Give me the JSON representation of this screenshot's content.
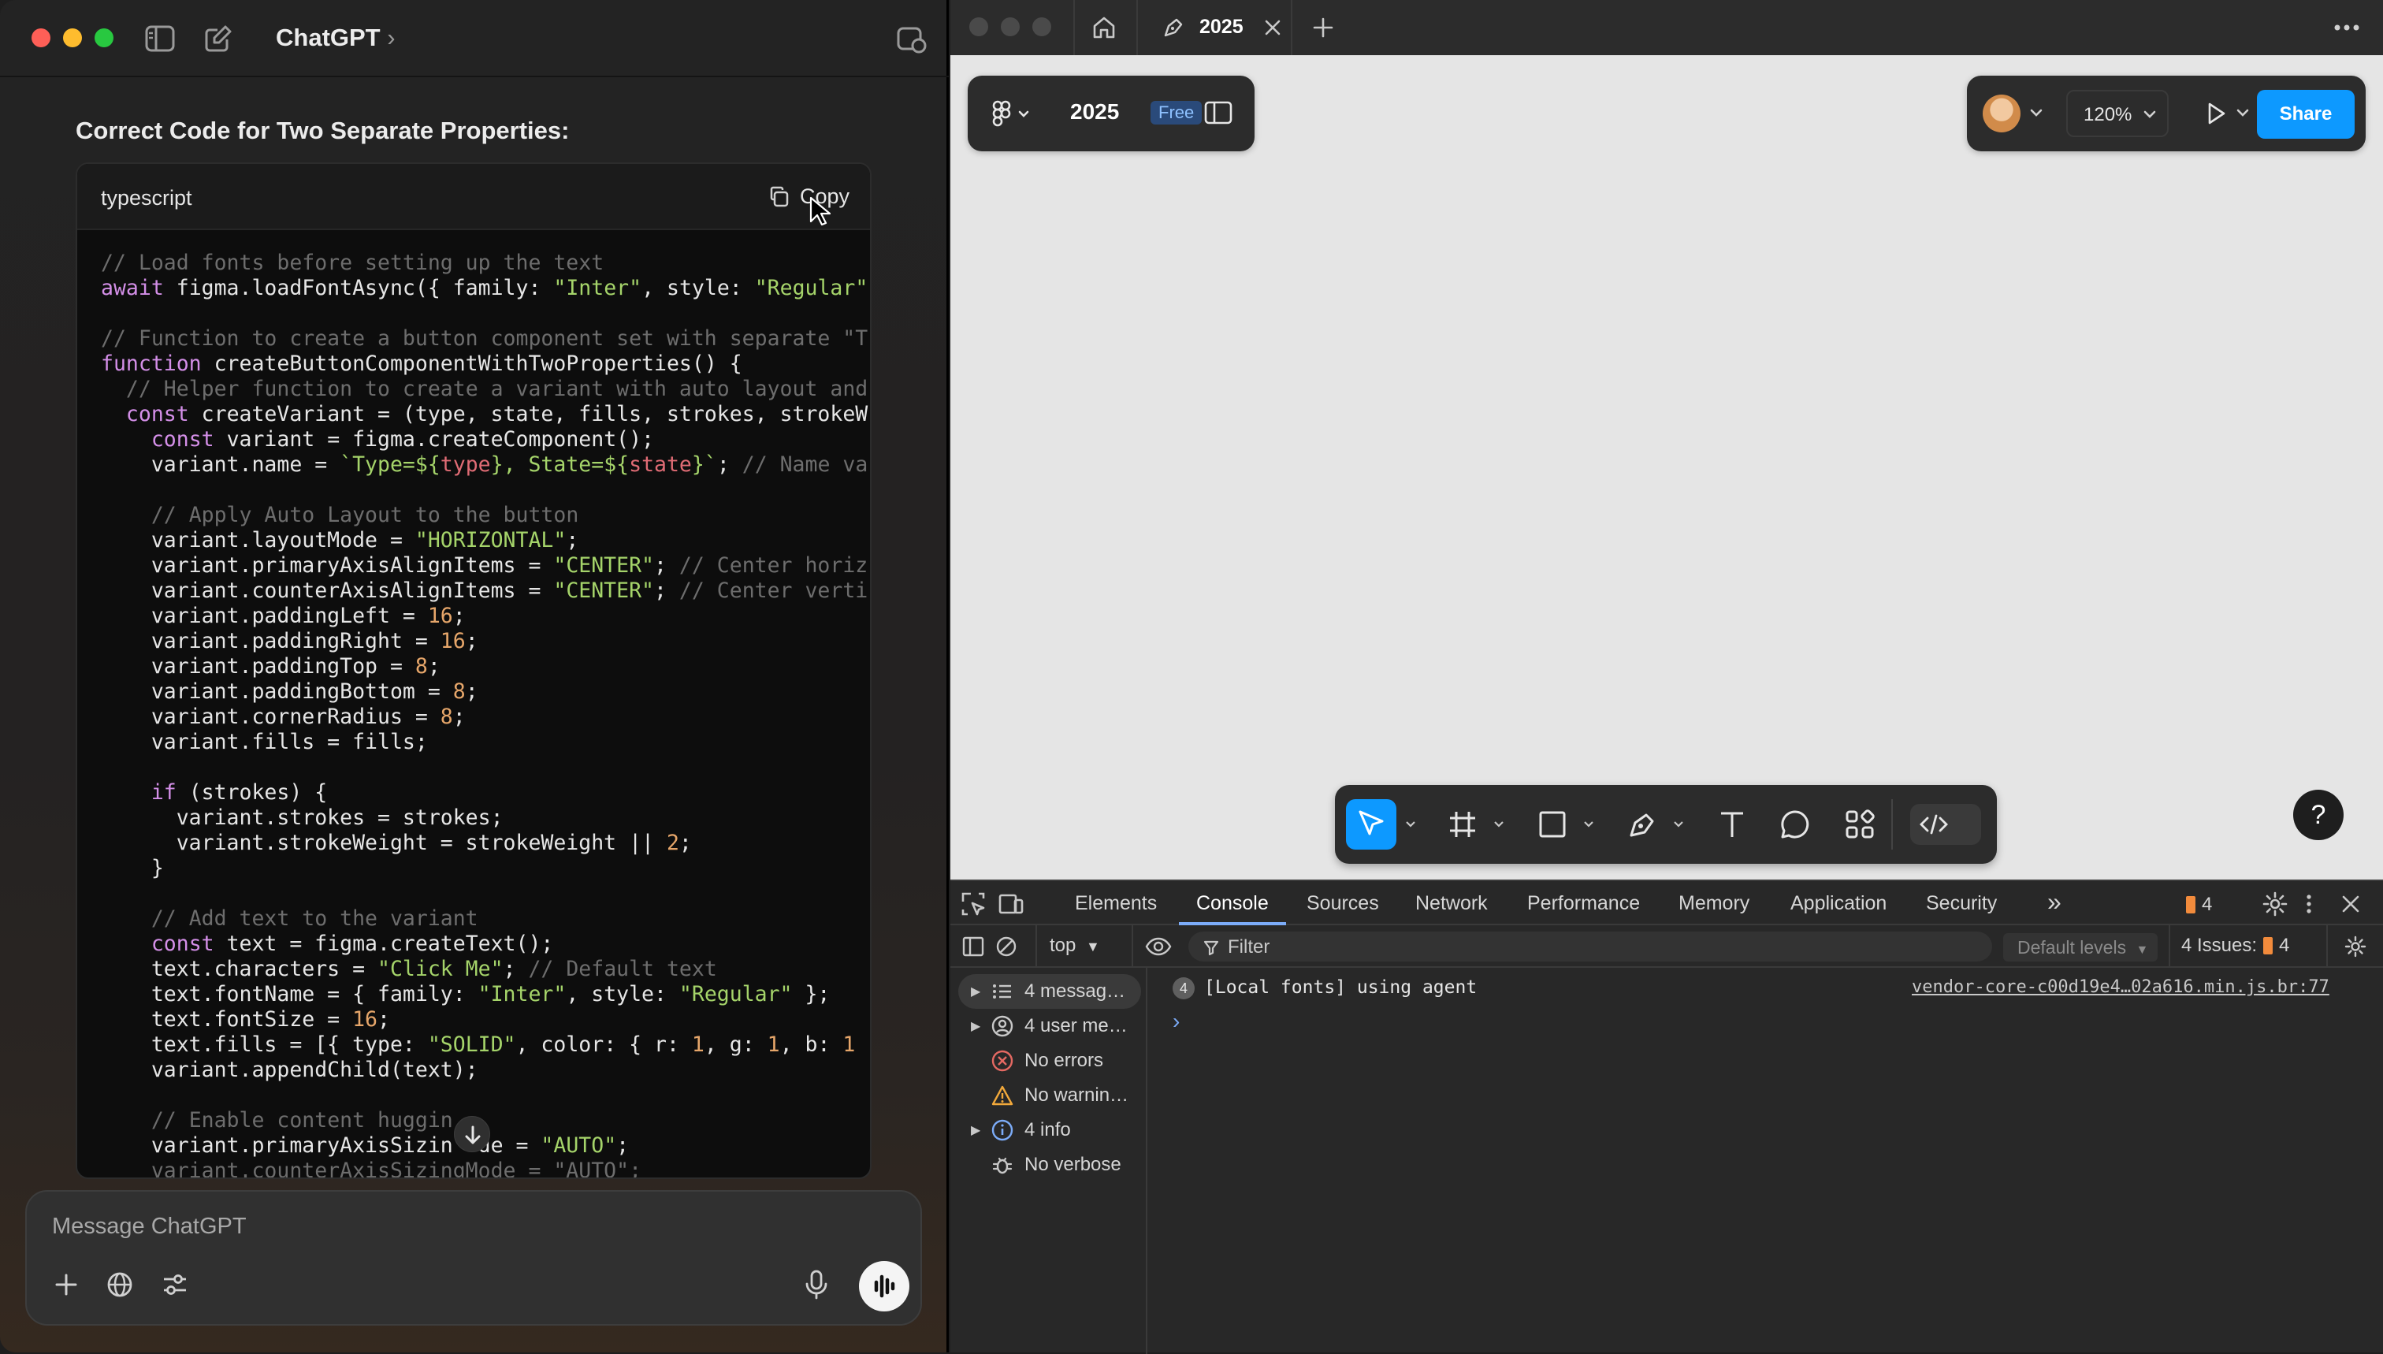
{
  "chat": {
    "title": "ChatGPT",
    "title_chevron": "›",
    "heading": "Correct Code for Two Separate Properties:",
    "code_lang": "typescript",
    "copy_label": "Copy",
    "composer_placeholder": "Message ChatGPT",
    "code_lines": [
      [
        [
          "c",
          "// Load fonts before setting up the text"
        ]
      ],
      [
        [
          "k",
          "await "
        ],
        [
          "t",
          "figma.loadFontAsync({ "
        ],
        [
          "t",
          "family"
        ],
        [
          "t",
          ": "
        ],
        [
          "s",
          "\"Inter\""
        ],
        [
          "t",
          ", "
        ],
        [
          "t",
          "style"
        ],
        [
          "t",
          ": "
        ],
        [
          "s",
          "\"Regular\""
        ]
      ],
      [
        [
          "t",
          ""
        ]
      ],
      [
        [
          "c",
          "// Function to create a button component set with separate \"T"
        ]
      ],
      [
        [
          "k",
          "function "
        ],
        [
          "t",
          "createButtonComponentWithTwoProperties() {"
        ]
      ],
      [
        [
          "t",
          "  "
        ],
        [
          "c",
          "// Helper function to create a variant with auto layout and"
        ]
      ],
      [
        [
          "t",
          "  "
        ],
        [
          "k",
          "const "
        ],
        [
          "t",
          "createVariant = ("
        ],
        [
          "t",
          "type, state, fills, strokes, strokeW"
        ]
      ],
      [
        [
          "t",
          "    "
        ],
        [
          "k",
          "const "
        ],
        [
          "t",
          "variant = figma.createComponent();"
        ]
      ],
      [
        [
          "t",
          "    variant.name = "
        ],
        [
          "s",
          "`Type=${"
        ],
        [
          "v",
          "type"
        ],
        [
          "s",
          "}, State=${"
        ],
        [
          "v",
          "state"
        ],
        [
          "s",
          "}`"
        ],
        [
          "t",
          "; "
        ],
        [
          "c",
          "// Name va"
        ]
      ],
      [
        [
          "t",
          ""
        ]
      ],
      [
        [
          "t",
          "    "
        ],
        [
          "c",
          "// Apply Auto Layout to the button"
        ]
      ],
      [
        [
          "t",
          "    variant.layoutMode = "
        ],
        [
          "s",
          "\"HORIZONTAL\""
        ],
        [
          "t",
          ";"
        ]
      ],
      [
        [
          "t",
          "    variant.primaryAxisAlignItems = "
        ],
        [
          "s",
          "\"CENTER\""
        ],
        [
          "t",
          "; "
        ],
        [
          "c",
          "// Center horiz"
        ]
      ],
      [
        [
          "t",
          "    variant.counterAxisAlignItems = "
        ],
        [
          "s",
          "\"CENTER\""
        ],
        [
          "t",
          "; "
        ],
        [
          "c",
          "// Center verti"
        ]
      ],
      [
        [
          "t",
          "    variant.paddingLeft = "
        ],
        [
          "n",
          "16"
        ],
        [
          "t",
          ";"
        ]
      ],
      [
        [
          "t",
          "    variant.paddingRight = "
        ],
        [
          "n",
          "16"
        ],
        [
          "t",
          ";"
        ]
      ],
      [
        [
          "t",
          "    variant.paddingTop = "
        ],
        [
          "n",
          "8"
        ],
        [
          "t",
          ";"
        ]
      ],
      [
        [
          "t",
          "    variant.paddingBottom = "
        ],
        [
          "n",
          "8"
        ],
        [
          "t",
          ";"
        ]
      ],
      [
        [
          "t",
          "    variant.cornerRadius = "
        ],
        [
          "n",
          "8"
        ],
        [
          "t",
          ";"
        ]
      ],
      [
        [
          "t",
          "    variant.fills = fills;"
        ]
      ],
      [
        [
          "t",
          ""
        ]
      ],
      [
        [
          "t",
          "    "
        ],
        [
          "k",
          "if "
        ],
        [
          "t",
          "(strokes) {"
        ]
      ],
      [
        [
          "t",
          "      variant.strokes = strokes;"
        ]
      ],
      [
        [
          "t",
          "      variant.strokeWeight = strokeWeight || "
        ],
        [
          "n",
          "2"
        ],
        [
          "t",
          ";"
        ]
      ],
      [
        [
          "t",
          "    }"
        ]
      ],
      [
        [
          "t",
          ""
        ]
      ],
      [
        [
          "t",
          "    "
        ],
        [
          "c",
          "// Add text to the variant"
        ]
      ],
      [
        [
          "t",
          "    "
        ],
        [
          "k",
          "const "
        ],
        [
          "t",
          "text = figma.createText();"
        ]
      ],
      [
        [
          "t",
          "    text.characters = "
        ],
        [
          "s",
          "\"Click Me\""
        ],
        [
          "t",
          "; "
        ],
        [
          "c",
          "// Default text"
        ]
      ],
      [
        [
          "t",
          "    text.fontName = { family: "
        ],
        [
          "s",
          "\"Inter\""
        ],
        [
          "t",
          ", style: "
        ],
        [
          "s",
          "\"Regular\""
        ],
        [
          "t",
          " };"
        ]
      ],
      [
        [
          "t",
          "    text.fontSize = "
        ],
        [
          "n",
          "16"
        ],
        [
          "t",
          ";"
        ]
      ],
      [
        [
          "t",
          "    text.fills = [{ type: "
        ],
        [
          "s",
          "\"SOLID\""
        ],
        [
          "t",
          ", color: { r: "
        ],
        [
          "n",
          "1"
        ],
        [
          "t",
          ", g: "
        ],
        [
          "n",
          "1"
        ],
        [
          "t",
          ", b: "
        ],
        [
          "n",
          "1"
        ]
      ],
      [
        [
          "t",
          "    variant.appendChild(text);"
        ]
      ],
      [
        [
          "t",
          ""
        ]
      ],
      [
        [
          "t",
          "    "
        ],
        [
          "c",
          "// Enable content huggin"
        ]
      ],
      [
        [
          "t",
          "    variant.primaryAxisSizin"
        ],
        [
          "t",
          "  de = "
        ],
        [
          "s",
          "\"AUTO\""
        ],
        [
          "t",
          ";"
        ]
      ],
      [
        [
          "c",
          "    variant.counterAxisSizingMode = \"AUTO\";"
        ]
      ]
    ]
  },
  "figma": {
    "tab_title": "2025",
    "file_name": "2025",
    "plan_badge": "Free",
    "zoom": "120%",
    "share_label": "Share",
    "help_label": "?"
  },
  "devtools": {
    "tabs": [
      "Elements",
      "Console",
      "Sources",
      "Network",
      "Performance",
      "Memory",
      "Application",
      "Security"
    ],
    "active_tab": "Console",
    "more_tabs": "»",
    "issues_badge_count": "4",
    "context": "top",
    "filter_placeholder": "Filter",
    "levels": "Default levels",
    "issues_label": "4 Issues:",
    "issues_count": "4",
    "sidebar": [
      {
        "label": "4 messag…",
        "icon": "list-icon",
        "expandable": true
      },
      {
        "label": "4 user me…",
        "icon": "user-icon",
        "expandable": true
      },
      {
        "label": "No errors",
        "icon": "error-icon",
        "expandable": false
      },
      {
        "label": "No warnin…",
        "icon": "warning-icon",
        "expandable": false
      },
      {
        "label": "4 info",
        "icon": "info-icon",
        "expandable": true
      },
      {
        "label": "No verbose",
        "icon": "bug-icon",
        "expandable": false
      }
    ],
    "log": {
      "count": "4",
      "message": "[Local fonts] using agent",
      "source": "vendor-core-c00d19e4…02a616.min.js.br:77"
    },
    "prompt": "›"
  },
  "colors": {
    "accent_blue": "#0d99ff",
    "issue_orange": "#f28b3c"
  }
}
